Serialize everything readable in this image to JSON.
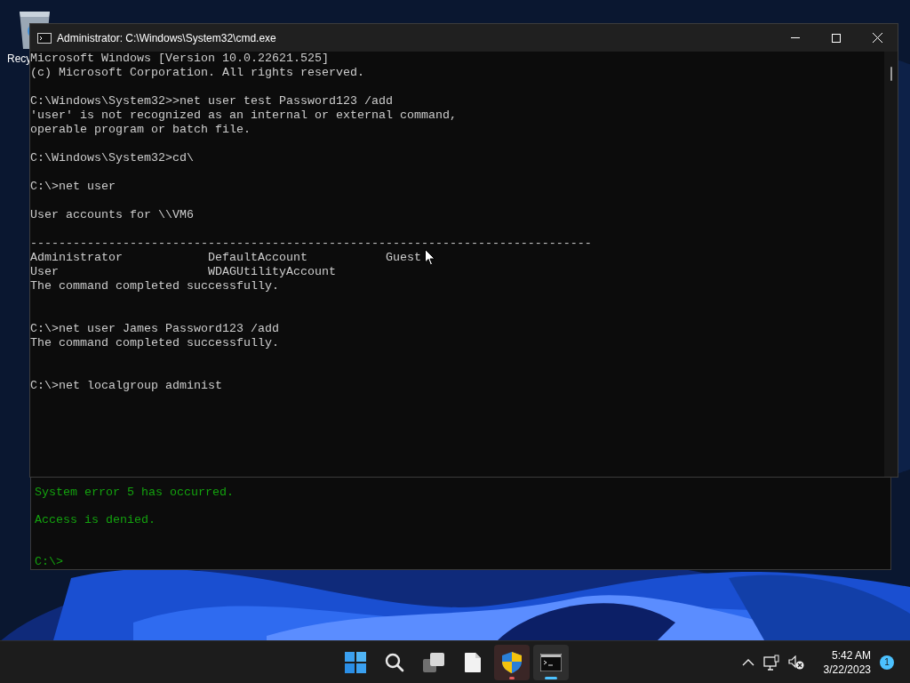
{
  "desktop_icon": {
    "label": "Recy"
  },
  "back_window": {
    "lines": [
      {
        "kind": "text",
        "text": "System error 5 has occurred."
      },
      {
        "kind": "blank"
      },
      {
        "kind": "text",
        "text": "Access is denied."
      },
      {
        "kind": "blank"
      },
      {
        "kind": "blank"
      },
      {
        "kind": "text",
        "text": "C:\\>"
      }
    ]
  },
  "window": {
    "title": "Administrator: C:\\Windows\\System32\\cmd.exe",
    "lines": [
      {
        "kind": "text",
        "text": "Microsoft Windows [Version 10.0.22621.525]"
      },
      {
        "kind": "text",
        "text": "(c) Microsoft Corporation. All rights reserved."
      },
      {
        "kind": "blank"
      },
      {
        "kind": "text",
        "text": "C:\\Windows\\System32>>net user test Password123 /add"
      },
      {
        "kind": "text",
        "text": "'user' is not recognized as an internal or external command,"
      },
      {
        "kind": "text",
        "text": "operable program or batch file."
      },
      {
        "kind": "blank"
      },
      {
        "kind": "text",
        "text": "C:\\Windows\\System32>cd\\"
      },
      {
        "kind": "blank"
      },
      {
        "kind": "text",
        "text": "C:\\>net user"
      },
      {
        "kind": "blank"
      },
      {
        "kind": "text",
        "text": "User accounts for \\\\VM6"
      },
      {
        "kind": "blank"
      },
      {
        "kind": "text",
        "text": "-------------------------------------------------------------------------------"
      },
      {
        "kind": "text",
        "text": "Administrator            DefaultAccount           Guest"
      },
      {
        "kind": "text",
        "text": "User                     WDAGUtilityAccount"
      },
      {
        "kind": "text",
        "text": "The command completed successfully."
      },
      {
        "kind": "blank"
      },
      {
        "kind": "blank"
      },
      {
        "kind": "text",
        "text": "C:\\>net user James Password123 /add"
      },
      {
        "kind": "text",
        "text": "The command completed successfully."
      },
      {
        "kind": "blank"
      },
      {
        "kind": "blank"
      },
      {
        "kind": "text",
        "text": "C:\\>net localgroup administ"
      }
    ]
  },
  "taskbar": {
    "apps": [
      {
        "kind": "start",
        "active": false,
        "alert": false
      },
      {
        "kind": "search",
        "active": false,
        "alert": false
      },
      {
        "kind": "task_view",
        "active": false,
        "alert": false
      },
      {
        "kind": "file",
        "active": false,
        "alert": false
      },
      {
        "kind": "shield",
        "active": false,
        "alert": true
      },
      {
        "kind": "terminal",
        "active": true,
        "alert": false
      }
    ],
    "time": "5:42 AM",
    "date": "3/22/2023",
    "notifications": "1"
  }
}
